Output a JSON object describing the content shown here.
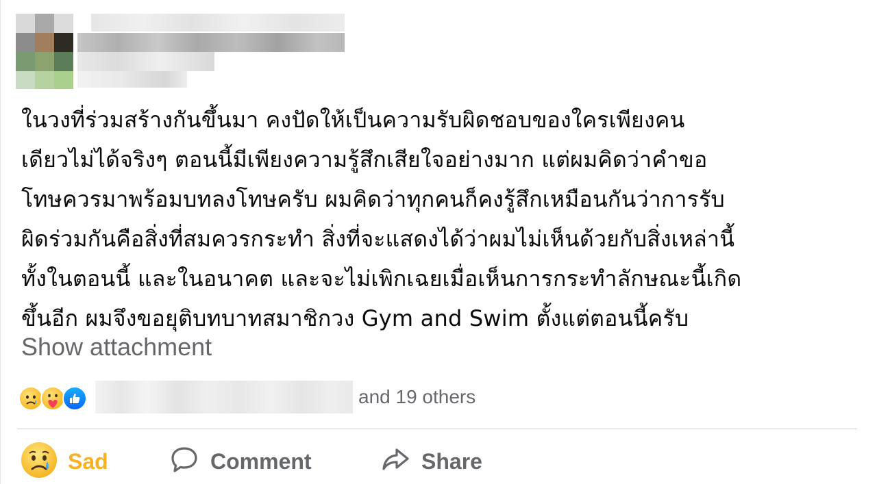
{
  "post": {
    "text_lines": [
      "ในวงที่ร่วมสร้างกันขึ้นมา คงปัดให้เป็นความรับผิดชอบของใครเพียงคน",
      "เดียวไม่ได้จริงๆ ตอนนี้มีเพียงความรู้สึกเสียใจอย่างมาก แต่ผมคิดว่าคำขอ",
      "โทษควรมาพร้อมบทลงโทษครับ ผมคิดว่าทุกคนก็คงรู้สึกเหมือนกันว่าการรับ",
      "ผิดร่วมกันคือสิ่งที่สมควรกระทำ สิ่งที่จะแสดงได้ว่าผมไม่เห็นด้วยกับสิ่งเหล่านี้",
      "ทั้งในตอนนี้ และในอนาคต และจะไม่เพิกเฉยเมื่อเห็นการกระทำลักษณะนี้เกิด",
      "ขึ้นอีก ผมจึงขอยุติบทบาทสมาชิกวง Gym and Swim ตั้งแต่ตอนนี้ครับ"
    ],
    "show_attachment": "Show attachment"
  },
  "reactions": {
    "icons": [
      "sad-reaction-icon",
      "care-reaction-icon",
      "like-reaction-icon"
    ],
    "summary_suffix": "and 19 others"
  },
  "actions": {
    "sad_label": "Sad",
    "comment_label": "Comment",
    "share_label": "Share"
  },
  "colors": {
    "sad_accent": "#f7b125",
    "secondary_text": "#65676b",
    "like_blue": "#0866ff"
  }
}
